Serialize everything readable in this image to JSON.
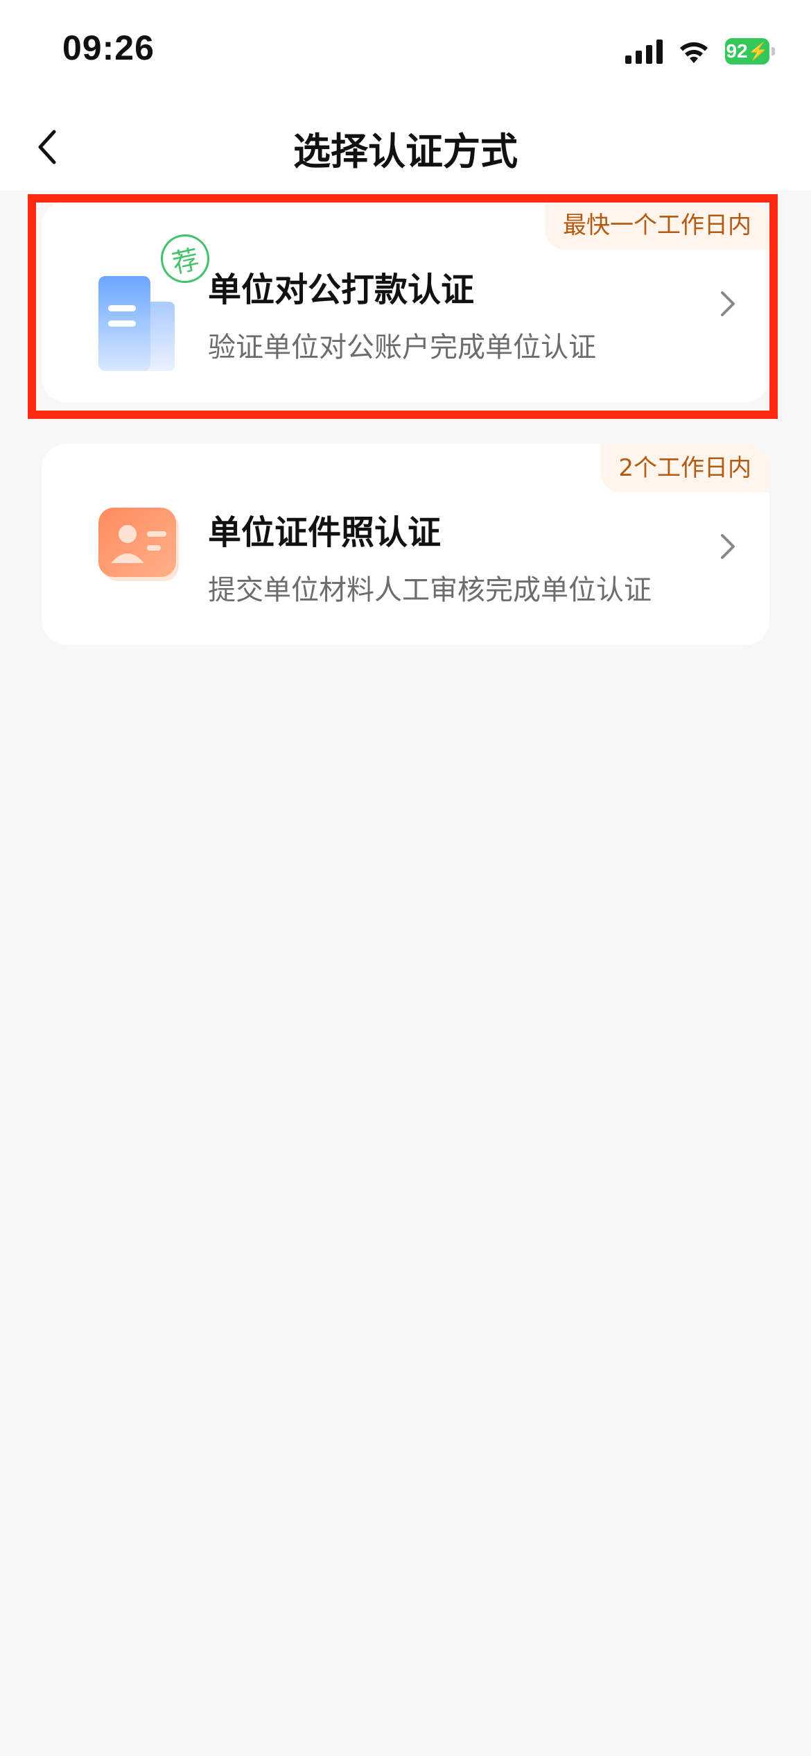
{
  "status_bar": {
    "time": "09:26",
    "battery": "92",
    "icons": [
      "signal-icon",
      "wifi-icon",
      "battery-charging-icon"
    ]
  },
  "nav": {
    "title": "选择认证方式",
    "back_icon": "chevron-left-icon"
  },
  "options": [
    {
      "tag": "最快一个工作日内",
      "title": "单位对公打款认证",
      "subtitle": "验证单位对公账户完成单位认证",
      "icon": "building-icon",
      "badge": "荐",
      "highlighted": true
    },
    {
      "tag": "2个工作日内",
      "title": "单位证件照认证",
      "subtitle": "提交单位材料人工审核完成单位认证",
      "icon": "id-card-icon",
      "highlighted": false
    }
  ],
  "colors": {
    "highlight": "#ff2a12",
    "tag_text": "#b35a13",
    "tag_bg": "#fff5ec",
    "badge": "#43c26a",
    "battery": "#34c759"
  }
}
